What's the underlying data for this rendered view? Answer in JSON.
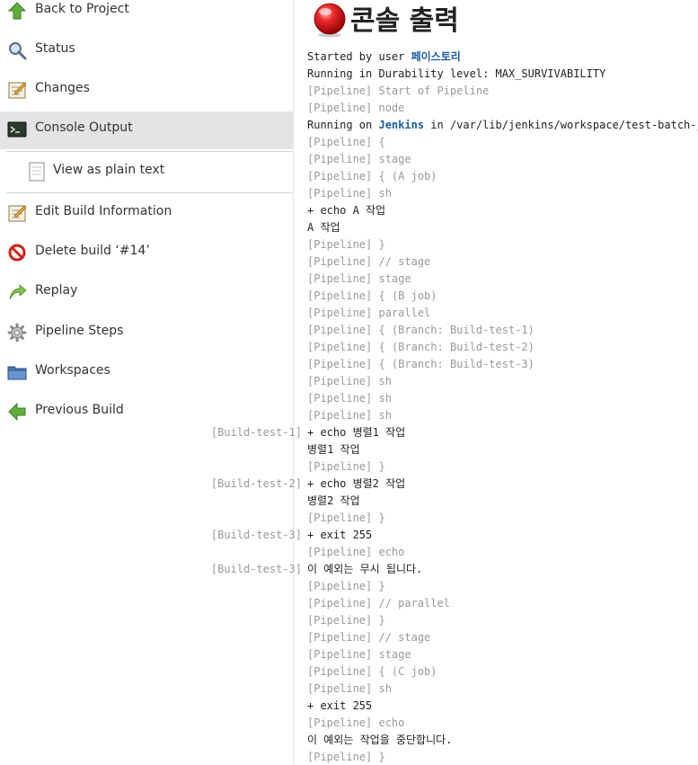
{
  "sidebar": {
    "back_to_project": "Back to Project",
    "status": "Status",
    "changes": "Changes",
    "console_output": "Console Output",
    "view_plain_text": "View as plain text",
    "edit_build_info": "Edit Build Information",
    "delete_build": "Delete build ‘#14’",
    "replay": "Replay",
    "pipeline_steps": "Pipeline Steps",
    "workspaces": "Workspaces",
    "previous_build": "Previous Build"
  },
  "page": {
    "title": "콘솔 출력",
    "status_color": "#e02020"
  },
  "console": {
    "started_by_prefix": "Started by user ",
    "started_by_user": "페이스토리",
    "durability": "Running in Durability level: MAX_SURVIVABILITY",
    "l03": "[Pipeline] Start of Pipeline",
    "l04": "[Pipeline] node",
    "running_on_prefix": "Running on ",
    "running_on_node": "Jenkins",
    "running_on_suffix": " in /var/lib/jenkins/workspace/test-batch-job",
    "l06": "[Pipeline] {",
    "l07": "[Pipeline] stage",
    "l08": "[Pipeline] { (A job)",
    "l09": "[Pipeline] sh",
    "l10": "+ echo A 작업",
    "l11": "A 작업",
    "l12": "[Pipeline] }",
    "l13": "[Pipeline] // stage",
    "l14": "[Pipeline] stage",
    "l15": "[Pipeline] { (B job)",
    "l16": "[Pipeline] parallel",
    "l17": "[Pipeline] { (Branch: Build-test-1)",
    "l18": "[Pipeline] { (Branch: Build-test-2)",
    "l19": "[Pipeline] { (Branch: Build-test-3)",
    "l20": "[Pipeline] sh",
    "l21": "[Pipeline] sh",
    "l22": "[Pipeline] sh",
    "l23": "+ echo 병렬1 작업",
    "l24": "병렬1 작업",
    "l25": "[Pipeline] }",
    "l26": "+ echo 병렬2 작업",
    "l27": "병렬2 작업",
    "l28": "[Pipeline] }",
    "l29": "+ exit 255",
    "l30": "[Pipeline] echo",
    "l31": "이 예외는 무시 됩니다.",
    "l32": "[Pipeline] }",
    "l33": "[Pipeline] // parallel",
    "l34": "[Pipeline] }",
    "l35": "[Pipeline] // stage",
    "l36": "[Pipeline] stage",
    "l37": "[Pipeline] { (C job)",
    "l38": "[Pipeline] sh",
    "l39": "+ exit 255",
    "l40": "[Pipeline] echo",
    "l41": "이 예외는 작업을 중단합니다.",
    "l42": "[Pipeline] }"
  },
  "branch_tags": {
    "t1": "[Build-test-1]",
    "t2": "[Build-test-2]",
    "t3": "[Build-test-3]",
    "t4": "[Build-test-3]"
  }
}
